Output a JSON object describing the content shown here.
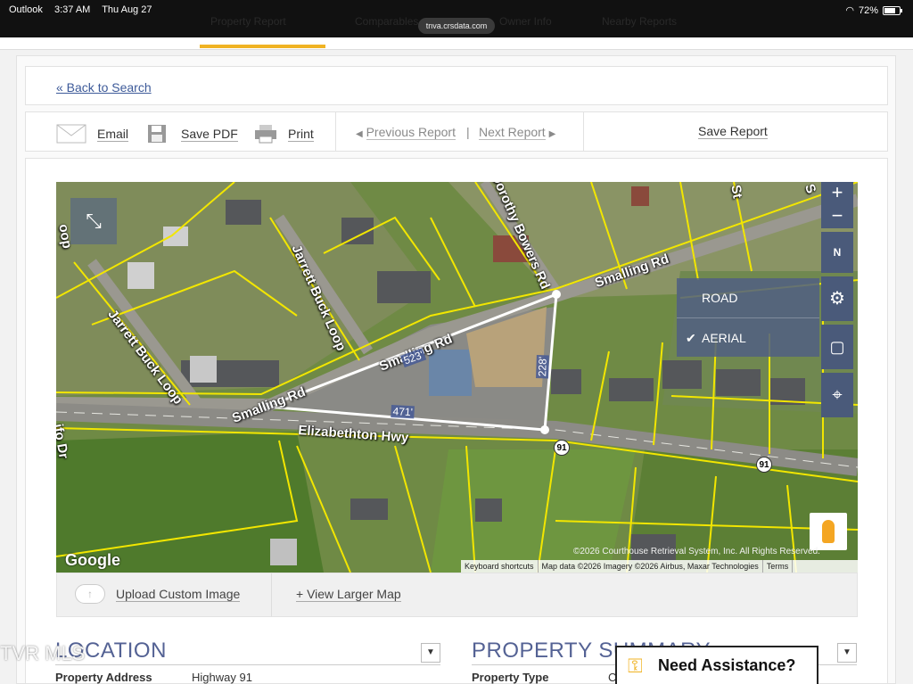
{
  "statusbar": {
    "app": "Outlook",
    "time": "3:37 AM",
    "date": "Thu Aug 27",
    "battery": "72%",
    "url": "tnva.crsdata.com"
  },
  "ghost_tabs": [
    "Property Report",
    "Comparables",
    "Owner Info",
    "Nearby Reports"
  ],
  "back_link": "« Back to Search",
  "toolbar": {
    "email": "Email",
    "save_pdf": "Save PDF",
    "print": "Print",
    "prev": "Previous Report",
    "next": "Next Report",
    "save_report": "Save Report"
  },
  "map": {
    "roads": {
      "smalling_upper": "Smalling Rd",
      "smalling_mid": "Smalling Rd",
      "smalling_lower": "Smalling Rd",
      "elizabethton": "Elizabethton Hwy",
      "jarrett_left": "Jarrett Buck Loop",
      "jarrett_mid": "Jarrett Buck Loop",
      "bowers": "Dorothy Bowers Rd",
      "loop_edge": "oop",
      "st": "St",
      "edge_s": "S",
      "edge_ifo": "ifo Dr"
    },
    "dimensions": {
      "top": "523'",
      "bottom": "471'",
      "right": "228'"
    },
    "route_shields": [
      "91",
      "91"
    ],
    "map_types": {
      "road": "ROAD",
      "aerial": "AERIAL",
      "selected": "aerial"
    },
    "controls": {
      "zoom_in": "+",
      "zoom_out": "−",
      "north": "N"
    },
    "google": "Google",
    "copyright": "©2026 Courthouse Retrieval System, Inc. All Rights Reserved.",
    "attribution": [
      "Keyboard shortcuts",
      "Map data ©2026 Imagery ©2026 Airbus, Maxar Technologies",
      "Terms"
    ]
  },
  "map_footer": {
    "upload": "Upload Custom Image",
    "view_larger": "+ View Larger Map"
  },
  "sections": {
    "location": {
      "title": "LOCATION",
      "field_label": "Property Address",
      "field_value": "Highway 91"
    },
    "summary": {
      "title": "PROPERTY SUMMARY",
      "field_label": "Property Type",
      "field_value": "C"
    }
  },
  "watermark": "TVR MLS",
  "assist": "Need Assistance?",
  "colors": {
    "accent": "#f0b323",
    "heading": "#546294",
    "link": "#3d5a99",
    "parcel_line": "#f2e600"
  }
}
